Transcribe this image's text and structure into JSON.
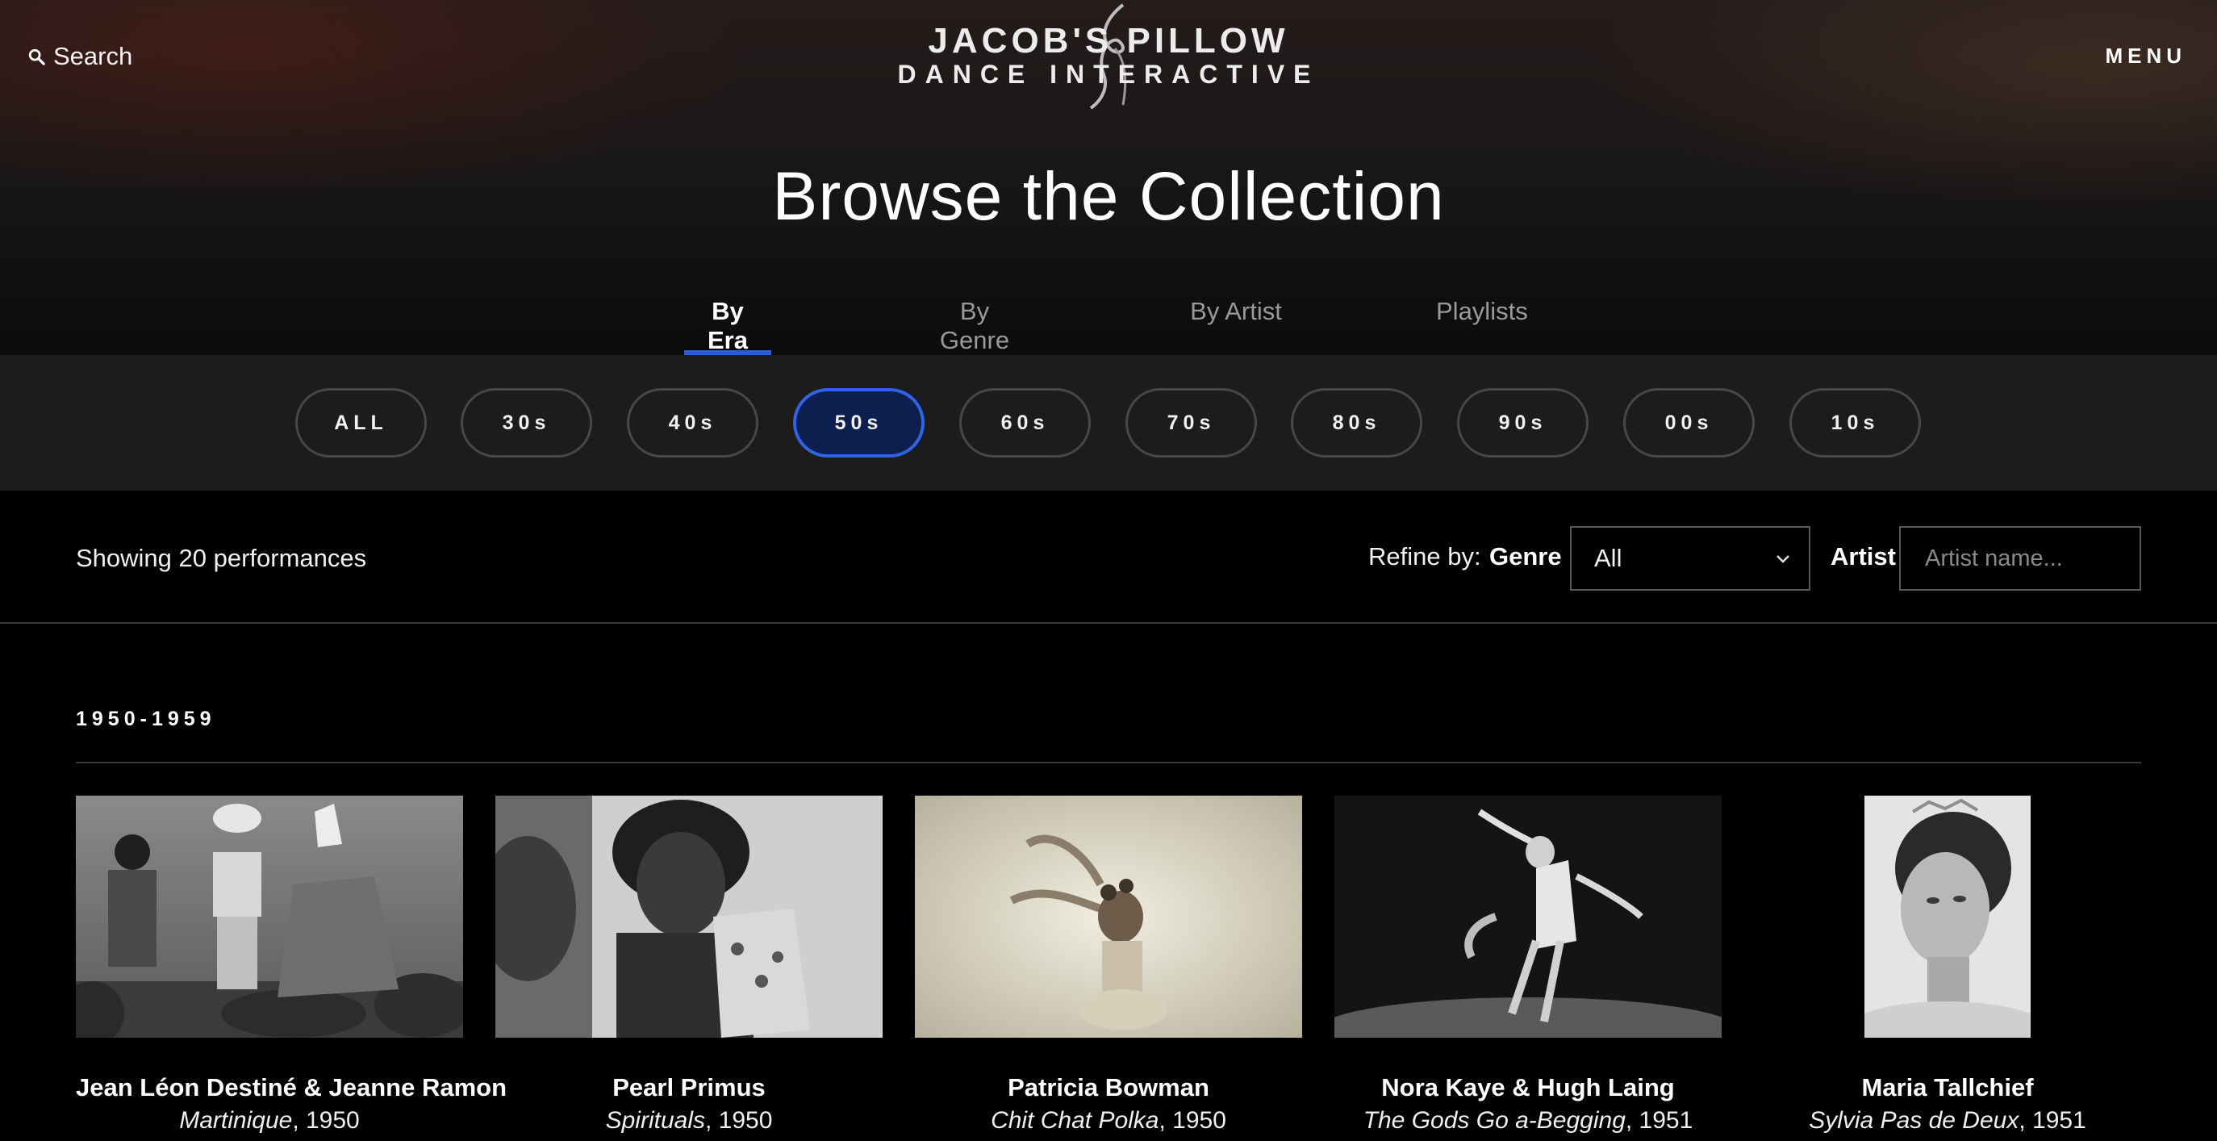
{
  "header": {
    "search_label": "Search",
    "menu_label": "MENU",
    "logo_line1": "JACOB'S PILLOW",
    "logo_line2": "DANCE INTERACTIVE"
  },
  "page_title": "Browse the Collection",
  "tabs": [
    {
      "label": "By Era",
      "active": true
    },
    {
      "label": "By Genre",
      "active": false
    },
    {
      "label": "By Artist",
      "active": false
    },
    {
      "label": "Playlists",
      "active": false
    }
  ],
  "eras": [
    {
      "label": "ALL",
      "selected": false
    },
    {
      "label": "30s",
      "selected": false
    },
    {
      "label": "40s",
      "selected": false
    },
    {
      "label": "50s",
      "selected": true
    },
    {
      "label": "60s",
      "selected": false
    },
    {
      "label": "70s",
      "selected": false
    },
    {
      "label": "80s",
      "selected": false
    },
    {
      "label": "90s",
      "selected": false
    },
    {
      "label": "00s",
      "selected": false
    },
    {
      "label": "10s",
      "selected": false
    }
  ],
  "filters": {
    "showing_text": "Showing 20 performances",
    "refine_label": "Refine by:",
    "genre_label": "Genre",
    "genre_value": "All",
    "artist_label": "Artist",
    "artist_placeholder": "Artist name..."
  },
  "section": {
    "decade_label": "1950-1959",
    "cards": [
      {
        "artist": "Jean Léon Destiné & Jeanne Ramon",
        "work": "Martinique",
        "year": ", 1950"
      },
      {
        "artist": "Pearl Primus",
        "work": "Spirituals",
        "year": ", 1950"
      },
      {
        "artist": "Patricia Bowman",
        "work": "Chit Chat Polka",
        "year": ", 1950"
      },
      {
        "artist": "Nora Kaye & Hugh Laing",
        "work": "The Gods Go a-Begging",
        "year": ", 1951"
      },
      {
        "artist": "Maria Tallchief",
        "work": "Sylvia Pas de Deux",
        "year": ", 1951"
      }
    ]
  },
  "colors": {
    "accent": "#2b5bd6",
    "selected_pill_fill": "#0c1f4e",
    "era_bar_bg": "#1c1c1c",
    "page_bg": "#000000"
  }
}
